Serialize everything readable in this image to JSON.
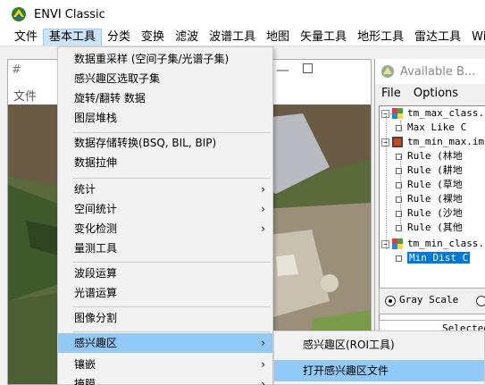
{
  "app": {
    "title": "ENVI Classic"
  },
  "menubar": {
    "items": [
      "文件",
      "基本工具",
      "分类",
      "变换",
      "滤波",
      "波谱工具",
      "地图",
      "矢量工具",
      "地形工具",
      "雷达工具",
      "Wind"
    ],
    "active": "基本工具"
  },
  "image_window": {
    "title_fragment": "#",
    "menu": "文件"
  },
  "available_bands": {
    "title": "Available B...",
    "menu": [
      "File",
      "Options"
    ],
    "tree": [
      "tm_max_class.",
      "Max Like C",
      "tm_min_max.im",
      "Rule (林地",
      "Rule (耕地",
      "Rule (草地",
      "Rule (裸地",
      "Rule (沙地",
      "Rule (其他",
      "tm_min_class.",
      "Min Dist C"
    ],
    "radio_gray": "Gray Scale",
    "selected_label": "Selected"
  },
  "dropdown": {
    "items": [
      "数据重采样 (空间子集/光谱子集)",
      "感兴趣区选取子集",
      "旋转/翻转 数据",
      "图层堆栈",
      "数据存储转换(BSQ, BIL, BIP)",
      "数据拉伸",
      "统计",
      "空间统计",
      "变化检测",
      "量测工具",
      "波段运算",
      "光谱运算",
      "图像分割",
      "感兴趣区",
      "镶嵌",
      "掩膜"
    ]
  },
  "submenu": {
    "items": [
      "感兴趣区(ROI工具)",
      "打开感兴趣区文件"
    ]
  },
  "colors": {
    "menu_highlight": "#91c9f7",
    "tree_selected": "#0078d7"
  }
}
